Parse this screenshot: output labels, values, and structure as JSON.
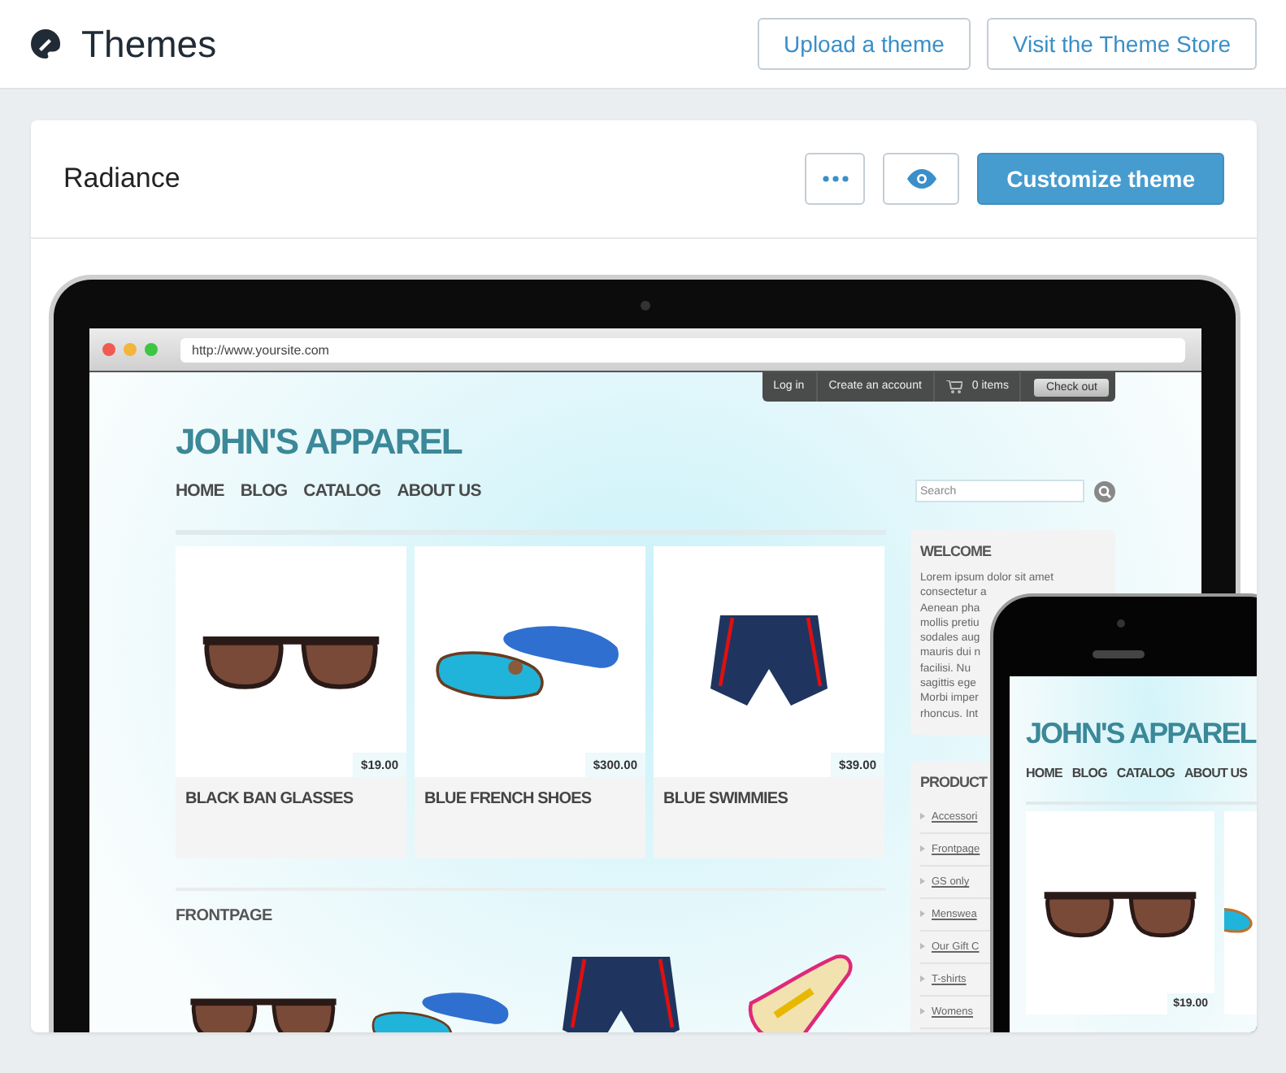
{
  "header": {
    "title": "Themes",
    "buttons": [
      "Upload a theme",
      "Visit the Theme Store"
    ]
  },
  "theme": {
    "name": "Radiance",
    "primary_button": "Customize theme"
  },
  "laptop": {
    "url": "http://www.yoursite.com",
    "top_bar": {
      "links": [
        "Log in",
        "Create an account"
      ],
      "cart": "0 items",
      "checkout": "Check out"
    },
    "logo": "JOHN'S APPAREL",
    "nav": [
      "HOME",
      "BLOG",
      "CATALOG",
      "ABOUT US"
    ],
    "search": {
      "placeholder": "Search"
    },
    "products": [
      {
        "kind": "glasses",
        "price": "$19.00",
        "name": "BLACK BAN GLASSES"
      },
      {
        "kind": "shoes",
        "price": "$300.00",
        "name": "BLUE FRENCH SHOES"
      },
      {
        "kind": "shorts",
        "price": "$39.00",
        "name": "BLUE SWIMMIES"
      }
    ],
    "frontpage_title": "FRONTPAGE",
    "frontpage_items": [
      {
        "kind": "glasses"
      },
      {
        "kind": "shoes"
      },
      {
        "kind": "shorts"
      },
      {
        "kind": "dotted-shoes"
      }
    ],
    "sidebar": {
      "welcome_title": "WELCOME",
      "welcome_lines": [
        "Lorem ipsum dolor sit amet",
        "consectetur a",
        "Aenean pha",
        "mollis pretiu",
        "sodales aug",
        "mauris dui n",
        "facilisi. Nu",
        "sagittis ege",
        "Morbi imper",
        "rhoncus. Int"
      ],
      "products_title": "PRODUCT",
      "links": [
        "Accessori",
        "Frontpage",
        "GS only",
        "Menswea",
        "Our Gift C",
        "T-shirts",
        "Womens"
      ]
    }
  },
  "phone": {
    "logo": "JOHN'S APPAREL",
    "nav": [
      "HOME",
      "BLOG",
      "CATALOG",
      "ABOUT US"
    ],
    "products": [
      {
        "kind": "glasses",
        "price": "$19.00"
      },
      {
        "kind": "shoes"
      }
    ]
  }
}
